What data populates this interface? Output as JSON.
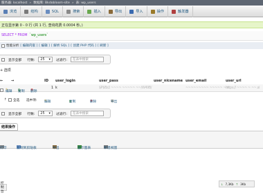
{
  "breadcrumb": {
    "server": "服务器: localhost",
    "database": "数据库: Bkdobloom-site",
    "table": "表: wp_users"
  },
  "tabs": [
    {
      "label": "浏览",
      "icon": "browse-icon",
      "color": "#5a7fb5"
    },
    {
      "label": "结构",
      "icon": "structure-icon",
      "color": "#7a7a7a"
    },
    {
      "label": "SQL",
      "icon": "sql-icon",
      "color": "#6a8dc0"
    },
    {
      "label": "搜索",
      "icon": "search-icon",
      "color": "#8a8a8a"
    },
    {
      "label": "插入",
      "icon": "insert-icon",
      "color": "#6aa84f"
    },
    {
      "label": "导出",
      "icon": "export-icon",
      "color": "#8a6a3a"
    },
    {
      "label": "导入",
      "icon": "import-icon",
      "color": "#3a6ab0"
    },
    {
      "label": "操作",
      "icon": "operations-icon",
      "color": "#9a7a2a"
    },
    {
      "label": "触发器",
      "icon": "triggers-icon",
      "color": "#b04040"
    }
  ],
  "notice": "正在显示第 0 - 0 行 (共 1 行, 查询花费 0.0004 秒。)",
  "sql": {
    "keyword": "SELECT * FROM",
    "table": "`wp_users`"
  },
  "sql_actions": {
    "label": "性能分析",
    "links": [
      "[ 编辑内嵌 ]",
      "[ 编辑 ]",
      "[ 解析 SQL ]",
      "[ 创建 PHP 代码 ]",
      "[ 刷新 ]"
    ]
  },
  "nav_top": {
    "show_all": "显示全部",
    "rows_label": "行数:",
    "rows_value": "25",
    "filter_label": "过滤行:",
    "filter_placeholder": "在表中搜索"
  },
  "options_label": "+ 选项",
  "table": {
    "headers": [
      "ID",
      "user_login",
      "user_pass",
      "user_nicename",
      "user_email",
      "user_url"
    ],
    "row": {
      "edit": "编辑",
      "copy": "复制",
      "delete": "删除",
      "id": "1",
      "login": "k",
      "pass": "$P$Bz2 ~~~~ ~~~~~ ~~/W49B/",
      "email": "~~~~~~~~~ ~~~~~ ~m",
      "url": "https:// ~~~~ ~ ~~.si"
    }
  },
  "bulk": {
    "select_all": "全选",
    "selected_label": "选中项:",
    "edit": "编辑",
    "copy": "复制",
    "delete": "删除",
    "export": "导出"
  },
  "nav_bottom": {
    "show_all": "显示全部",
    "rows_label": "行数:",
    "rows_value": "25",
    "filter_label": "过滤行:",
    "filter_placeholder": "在表中搜索"
  },
  "ops": {
    "title": "结果操作",
    "print": "打印",
    "copy_clipboard": "复制到剪贴板",
    "export": "导出",
    "chart": "显示图表",
    "view": "新建视图"
  },
  "footer_tab": "控制台",
  "zoom": {
    "left": "7,3Kb",
    "right": "3Kb"
  }
}
